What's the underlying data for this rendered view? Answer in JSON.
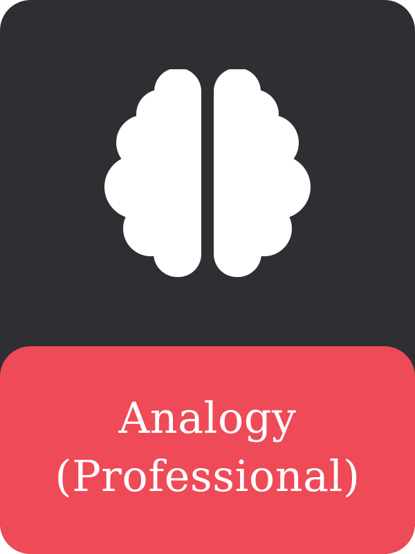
{
  "card": {
    "colors": {
      "background": "#2f2e33",
      "accent": "#ef4a58",
      "icon": "#ffffff",
      "text": "#ffffff"
    },
    "icon": "brain-icon",
    "title_lines": [
      "Analogy",
      "(Professional)"
    ]
  }
}
